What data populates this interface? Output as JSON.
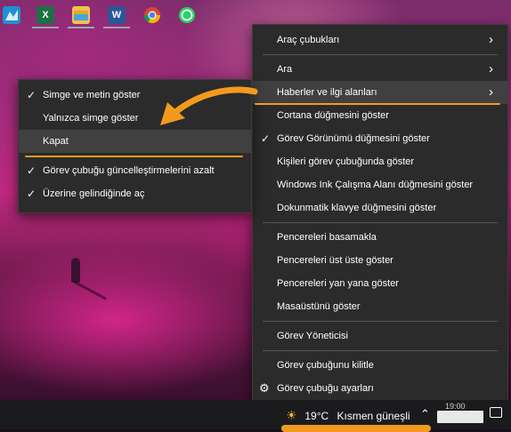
{
  "main_menu": {
    "items": [
      {
        "label": "Araç çubukları",
        "submenu": true
      },
      {
        "label": "Ara",
        "submenu": true
      },
      {
        "label": "Haberler ve ilgi alanları",
        "submenu": true,
        "highlighted": true
      },
      {
        "label": "Cortana düğmesini göster"
      },
      {
        "label": "Görev Görünümü düğmesini göster",
        "checked": true
      },
      {
        "label": "Kişileri görev çubuğunda göster"
      },
      {
        "label": "Windows Ink Çalışma Alanı düğmesini göster"
      },
      {
        "label": "Dokunmatik klavye düğmesini göster"
      },
      {
        "label": "Pencereleri basamakla"
      },
      {
        "label": "Pencereleri üst üste göster"
      },
      {
        "label": "Pencereleri yan yana göster"
      },
      {
        "label": "Masaüstünü göster"
      },
      {
        "label": "Görev Yöneticisi"
      },
      {
        "label": "Görev çubuğunu kilitle"
      },
      {
        "label": "Görev çubuğu ayarları"
      }
    ]
  },
  "sub_menu": {
    "items": [
      {
        "label": "Simge ve metin göster",
        "checked": true
      },
      {
        "label": "Yalnızca simge göster"
      },
      {
        "label": "Kapat",
        "highlighted": true
      },
      {
        "label": "Görev çubuğu güncelleştirmelerini azalt",
        "checked": true
      },
      {
        "label": "Üzerine gelindiğinde aç",
        "checked": true
      }
    ]
  },
  "taskbar": {
    "apps": [
      {
        "name": "maps",
        "icon": "maps-icon",
        "color": "#1e90d6"
      },
      {
        "name": "excel",
        "icon": "excel-icon",
        "color": "#1d7044",
        "glyph": "X"
      },
      {
        "name": "file-explorer",
        "icon": "folder-icon",
        "color": "#f2c14e"
      },
      {
        "name": "word",
        "icon": "word-icon",
        "color": "#2b5797",
        "glyph": "W"
      },
      {
        "name": "chrome",
        "icon": "chrome-icon",
        "color": "#db4437"
      },
      {
        "name": "whatsapp",
        "icon": "whatsapp-icon",
        "color": "#25d366"
      }
    ],
    "weather": {
      "temperature": "19°C",
      "condition": "Kısmen güneşli",
      "icon": "partly-sunny-icon"
    },
    "clock": "19:00"
  },
  "colors": {
    "accent": "#f39a1e",
    "menu_bg": "#2b2b2b",
    "highlight": "#404040"
  }
}
